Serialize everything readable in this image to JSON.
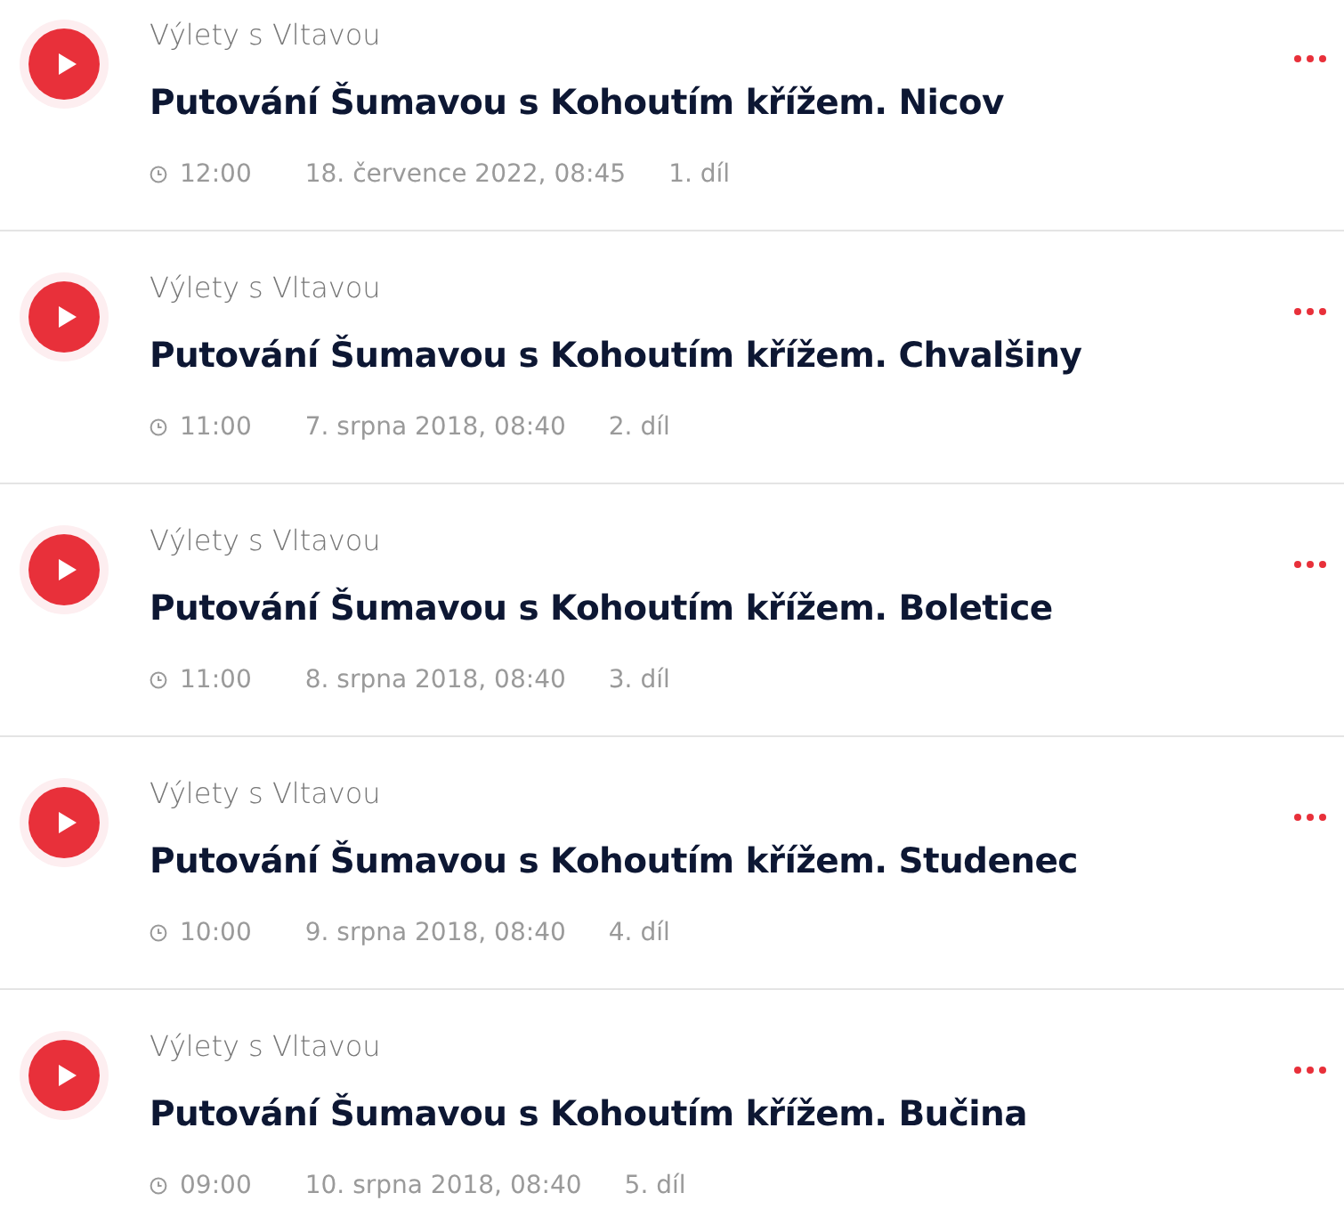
{
  "episodes": [
    {
      "show": "Výlety s Vltavou",
      "title": "Putování Šumavou s Kohoutím křížem. Nicov",
      "duration": "12:00",
      "date": "18. července 2022, 08:45",
      "part": "1. díl"
    },
    {
      "show": "Výlety s Vltavou",
      "title": "Putování Šumavou s Kohoutím křížem. Chvalšiny",
      "duration": "11:00",
      "date": "7. srpna 2018, 08:40",
      "part": "2. díl"
    },
    {
      "show": "Výlety s Vltavou",
      "title": "Putování Šumavou s Kohoutím křížem. Boletice",
      "duration": "11:00",
      "date": "8. srpna 2018, 08:40",
      "part": "3. díl"
    },
    {
      "show": "Výlety s Vltavou",
      "title": "Putování Šumavou s Kohoutím křížem. Studenec",
      "duration": "10:00",
      "date": "9. srpna 2018, 08:40",
      "part": "4. díl"
    },
    {
      "show": "Výlety s Vltavou",
      "title": "Putování Šumavou s Kohoutím křížem. Bučina",
      "duration": "09:00",
      "date": "10. srpna 2018, 08:40",
      "part": "5. díl"
    }
  ]
}
